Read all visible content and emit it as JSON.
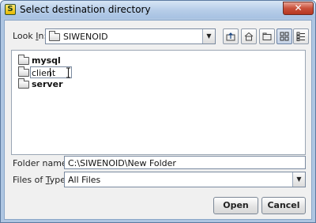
{
  "window": {
    "title": "Select destination directory",
    "app_icon_letter": "S",
    "close_glyph": "✕"
  },
  "look_in": {
    "label_pre": "Look ",
    "label_mnemonic": "I",
    "label_post": "n:",
    "value": "SIWENOID",
    "dropdown_glyph": "▼"
  },
  "toolbar": {
    "buttons": [
      {
        "name": "up-one-level-icon",
        "active": false
      },
      {
        "name": "home-icon",
        "active": false
      },
      {
        "name": "new-folder-icon",
        "active": false
      },
      {
        "name": "list-view-icon",
        "active": true
      },
      {
        "name": "details-view-icon",
        "active": false
      }
    ]
  },
  "file_list": {
    "items": [
      {
        "name": "mysql",
        "editing": false
      },
      {
        "name": "client",
        "editing": true
      },
      {
        "name": "server",
        "editing": false
      }
    ]
  },
  "folder_name": {
    "label": "Folder name:",
    "value": "C:\\SIWENOID\\New Folder"
  },
  "files_of_type": {
    "label_pre": "Files of ",
    "label_mnemonic": "T",
    "label_post": "ype:",
    "value": "All Files",
    "dropdown_glyph": "▼"
  },
  "buttons": {
    "open": "Open",
    "cancel": "Cancel"
  }
}
